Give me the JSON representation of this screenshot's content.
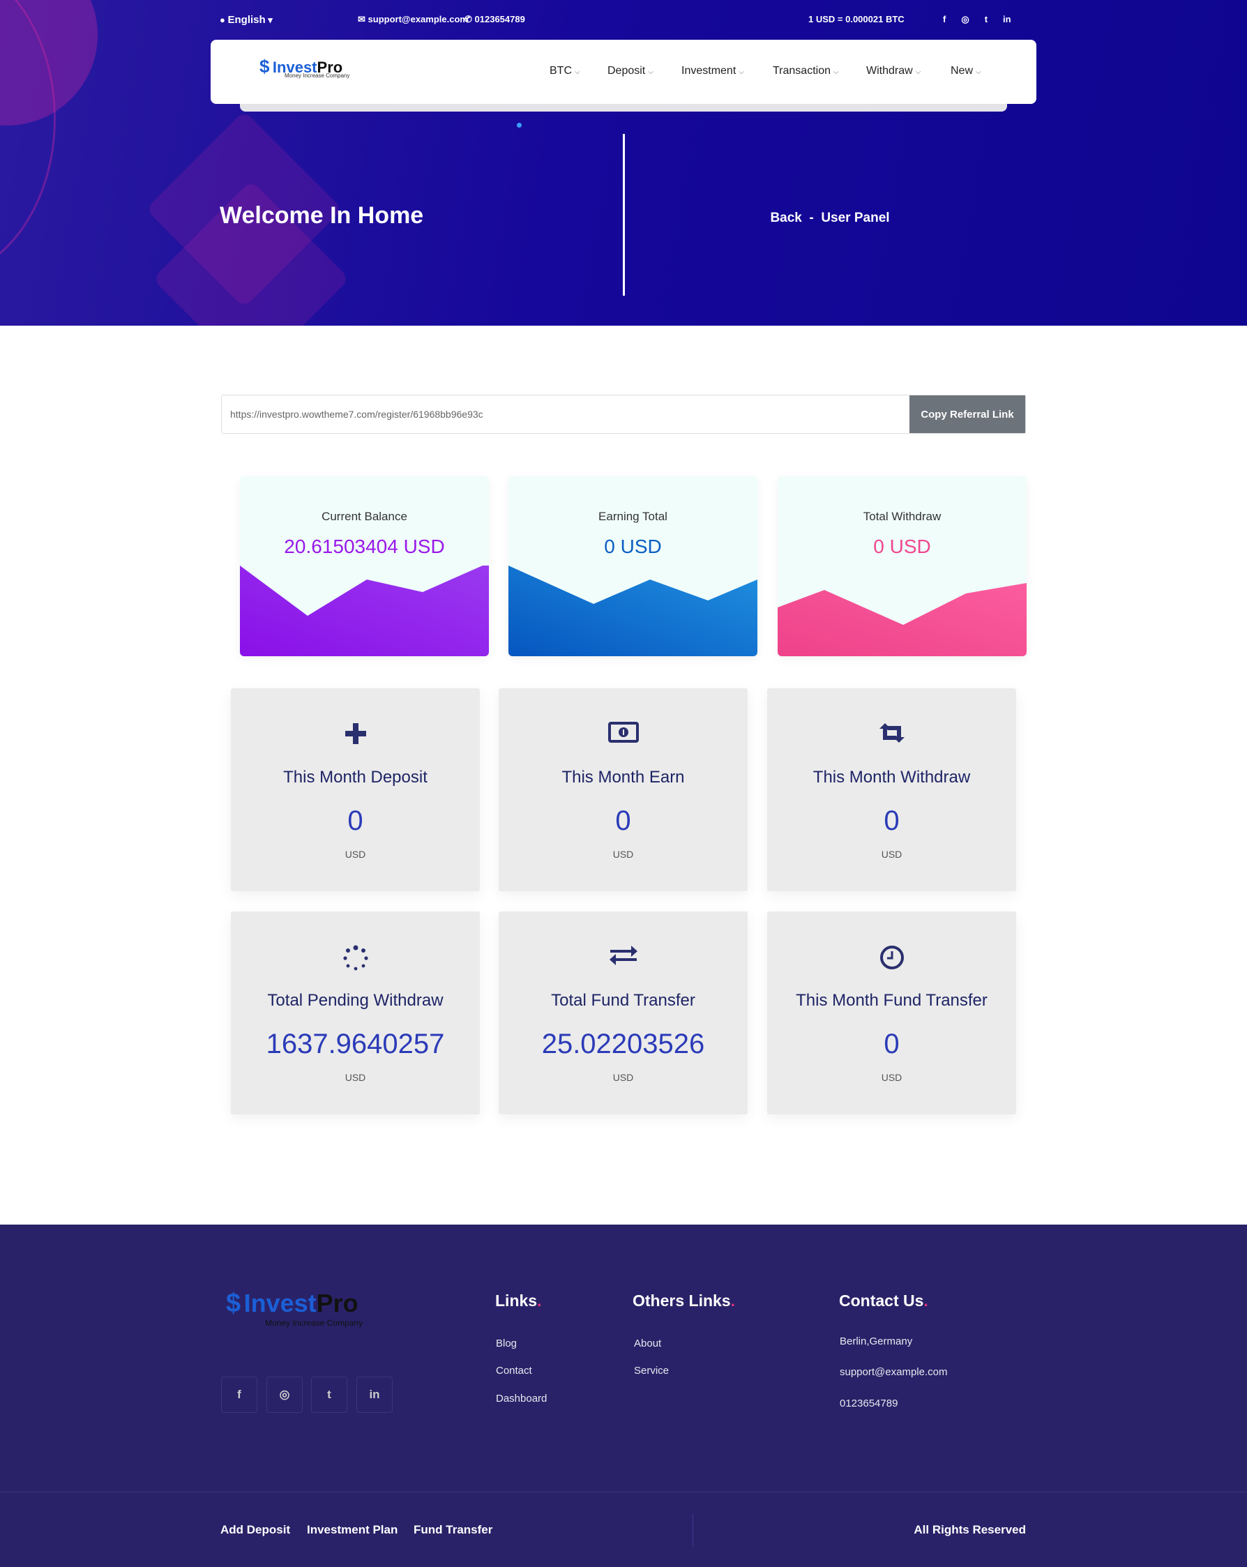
{
  "topbar": {
    "language": "English",
    "email": "support@example.com",
    "phone": "0123654789",
    "rate": "1 USD = 0.000021 BTC",
    "social": [
      "facebook-icon",
      "instagram-icon",
      "twitter-icon",
      "linkedin-icon"
    ]
  },
  "brand": {
    "name_a": "Invest",
    "name_b": "Pro",
    "tagline": "Money Increase Company"
  },
  "nav": {
    "items": [
      "BTC",
      "Deposit",
      "Investment",
      "Transaction",
      "Withdraw",
      "New"
    ]
  },
  "hero": {
    "title": "Welcome In Home",
    "breadcrumb": "Back  -  User Panel"
  },
  "referral": {
    "value": "https://investpro.wowtheme7.com/register/61968bb96e93c",
    "button": "Copy Referral Link"
  },
  "balance_cards": [
    {
      "label": "Current Balance",
      "value": "20.61503404 USD",
      "color": "#9a18e8"
    },
    {
      "label": "Earning Total",
      "value": "0 USD",
      "color": "#0b5fc2"
    },
    {
      "label": "Total Withdraw",
      "value": "0 USD",
      "color": "#f0478e"
    }
  ],
  "stat_cards": [
    {
      "icon": "plus-icon",
      "title": "This Month Deposit",
      "value": "0",
      "unit": "USD"
    },
    {
      "icon": "money-bill-icon",
      "title": "This Month Earn",
      "value": "0",
      "unit": "USD"
    },
    {
      "icon": "retweet-icon",
      "title": "This Month Withdraw",
      "value": "0",
      "unit": "USD"
    },
    {
      "icon": "spinner-icon",
      "title": "Total Pending Withdraw",
      "value": "1637.9640257",
      "unit": "USD"
    },
    {
      "icon": "exchange-icon",
      "title": "Total Fund Transfer",
      "value": "25.02203526",
      "unit": "USD"
    },
    {
      "icon": "clock-icon",
      "title": "This Month Fund Transfer",
      "value": "0",
      "unit": "USD"
    }
  ],
  "footer": {
    "links_title": "Links",
    "links": [
      "Blog",
      "Contact",
      "Dashboard"
    ],
    "others_title": "Others Links",
    "others": [
      "About",
      "Service"
    ],
    "contact_title": "Contact Us",
    "contact": [
      "Berlin,Germany",
      "support@example.com",
      "0123654789"
    ],
    "dot": ".",
    "bottom_links": [
      "Add Deposit",
      "Investment Plan",
      "Fund Transfer"
    ],
    "rights": "All Rights Reserved"
  }
}
